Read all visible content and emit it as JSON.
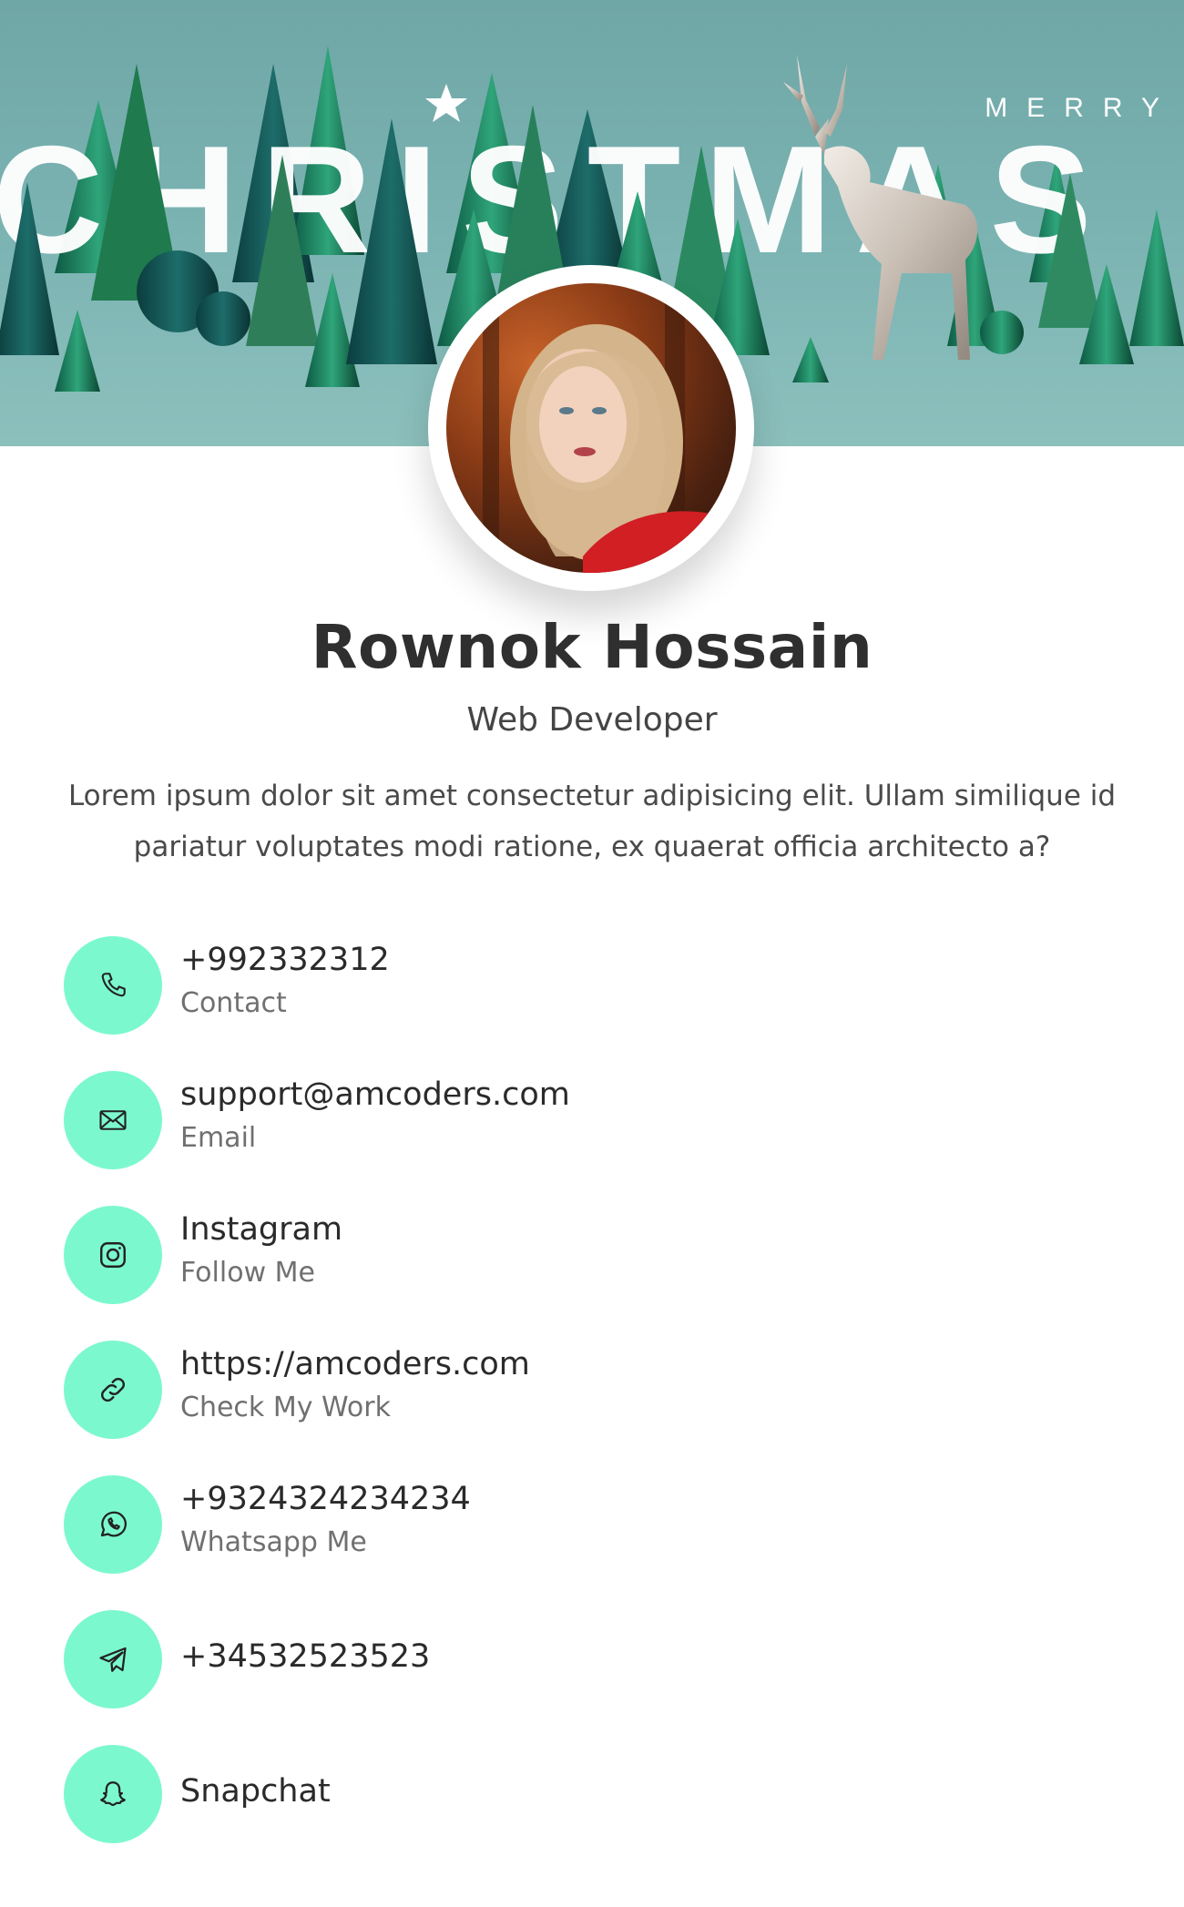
{
  "banner": {
    "merry": "MERRY",
    "christmas": "CHRISTMAS"
  },
  "profile": {
    "name": "Rownok Hossain",
    "role": "Web Developer",
    "bio": "Lorem ipsum dolor sit amet consectetur adipisicing elit. Ullam similique id pariatur voluptates modi ratione, ex quaerat officia architecto a?"
  },
  "contacts": [
    {
      "title": "+992332312",
      "subtitle": "Contact",
      "icon": "phone-icon"
    },
    {
      "title": "support@amcoders.com",
      "subtitle": "Email",
      "icon": "mail-icon"
    },
    {
      "title": "Instagram",
      "subtitle": "Follow Me",
      "icon": "instagram-icon"
    },
    {
      "title": "https://amcoders.com",
      "subtitle": "Check My Work",
      "icon": "link-icon"
    },
    {
      "title": "+9324324234234",
      "subtitle": "Whatsapp Me",
      "icon": "whatsapp-icon"
    },
    {
      "title": "+34532523523",
      "icon": "telegram-icon"
    },
    {
      "title": "Snapchat",
      "icon": "snapchat-icon"
    }
  ],
  "colors": {
    "icon_bg": "#7cf8cf",
    "banner_bg": "#7cb4b3"
  }
}
